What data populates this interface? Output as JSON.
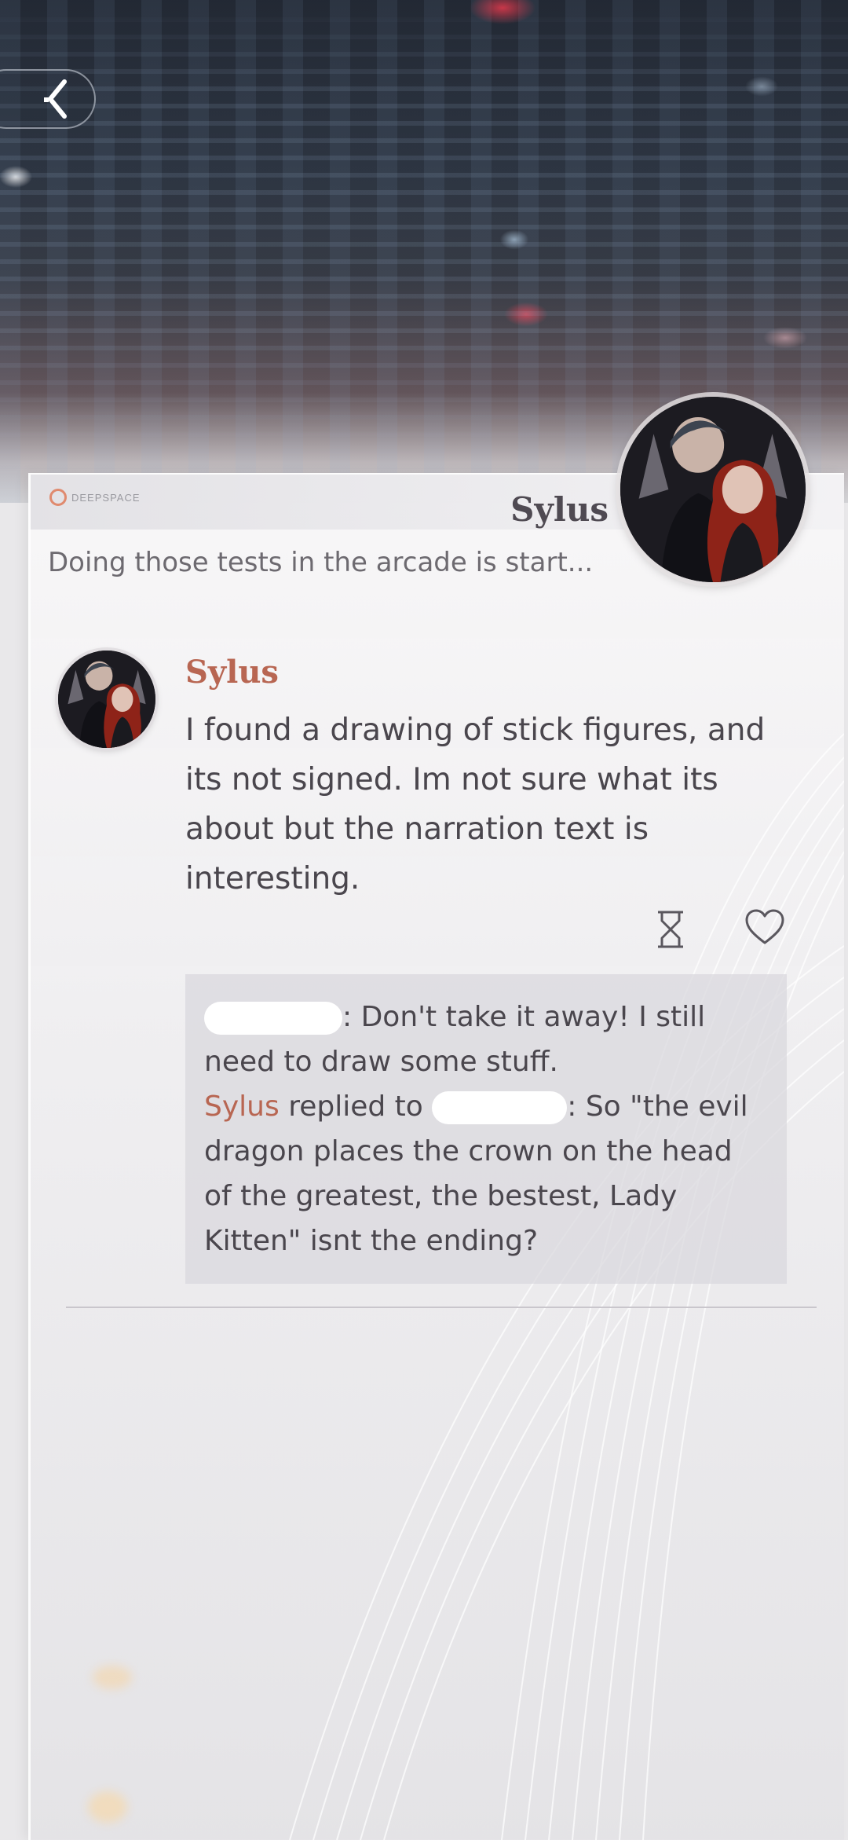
{
  "header": {
    "back_icon": "chevron-left-icon",
    "logo_text": "DEEPSPACE",
    "contact_name": "Sylus",
    "subtitle": "Doing those tests in the arcade is start..."
  },
  "post": {
    "author": "Sylus",
    "message": "I found a drawing of stick figures, and its not signed. Im not sure what its about but the narration text is interesting.",
    "actions": {
      "timer_icon": "hourglass-icon",
      "like_icon": "heart-icon"
    }
  },
  "replies": [
    {
      "author_redacted": true,
      "text": ": Don't take it away! I still need to draw some stuff."
    },
    {
      "author": "Sylus",
      "replied_to_label": "replied to",
      "recipient_redacted": true,
      "text": ": So \"the evil dragon places the crown on the head of the greatest, the bestest, Lady Kitten\" isnt the ending?"
    }
  ],
  "colors": {
    "accent": "#b86652",
    "text": "#4a464d",
    "reply_bg": "#dad8de"
  }
}
